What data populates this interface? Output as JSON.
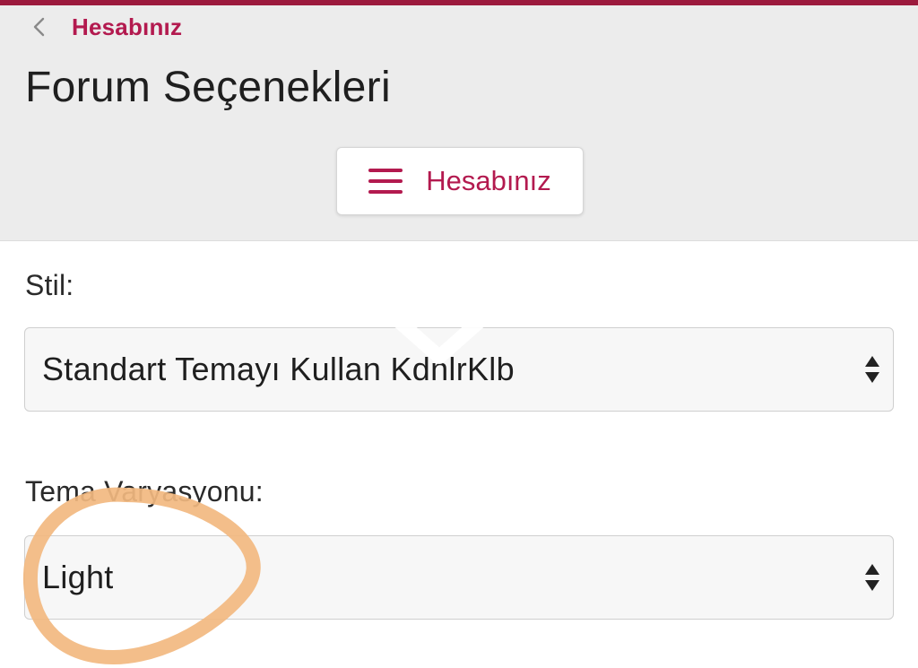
{
  "header": {
    "back_label": "Hesabınız",
    "title": "Forum Seçenekleri",
    "menu_button_label": "Hesabınız"
  },
  "form": {
    "style_label": "Stil:",
    "style_value": "Standart Temayı Kullan  KdnlrKlb",
    "variation_label": "Tema Varyasyonu:",
    "variation_value": "Light"
  },
  "colors": {
    "accent": "#b31a4f",
    "top_bar": "#9c1a3d",
    "header_bg": "#ececec",
    "annotation_circle": "#f2b880"
  },
  "icons": {
    "back": "chevron-left-icon",
    "menu": "hamburger-icon",
    "select": "sort-arrows-icon"
  }
}
